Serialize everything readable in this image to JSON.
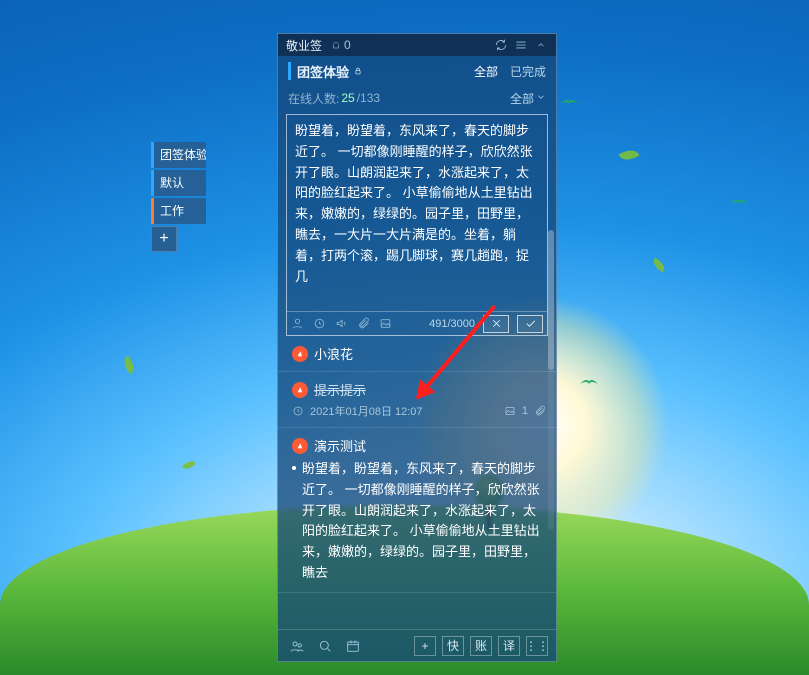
{
  "app_name": "敬业签",
  "bell_count": "0",
  "header": {
    "main_tab": "团签体验",
    "filter_all": "全部",
    "filter_done": "已完成"
  },
  "stats": {
    "label": "在线人数:",
    "online": "25",
    "sep": "/",
    "total": "133",
    "dropdown": "全部"
  },
  "editor": {
    "text": "盼望着，盼望着，东风来了，春天的脚步近了。\n一切都像刚睡醒的样子，欣欣然张开了眼。山朗润起来了，水涨起来了，太阳的脸红起来了。\n小草偷偷地从土里钻出来，嫩嫩的，绿绿的。园子里，田野里，瞧去，一大片一大片满是的。坐着，躺着，打两个滚，踢几脚球，赛几趟跑，捉几",
    "counter": "491/3000"
  },
  "items": [
    {
      "title": "小浪花"
    },
    {
      "title": "提示提示",
      "strike": true,
      "meta_time": "2021年01月08日 12:07",
      "meta_img": "1"
    },
    {
      "title": "演示测试",
      "body": "盼望着，盼望着，东风来了，春天的脚步近了。\n一切都像刚睡醒的样子，欣欣然张开了眼。山朗润起来了，水涨起来了，太阳的脸红起来了。\n小草偷偷地从土里钻出来，嫩嫩的，绿绿的。园子里，田野里，瞧去"
    }
  ],
  "side_tabs": {
    "t0": "团签体验",
    "t1": "默认",
    "t2": "工作",
    "add": "+"
  },
  "footer": {
    "b1": "+",
    "b2": "快",
    "b3": "账",
    "b4": "译",
    "b5": "⋮⋮"
  }
}
